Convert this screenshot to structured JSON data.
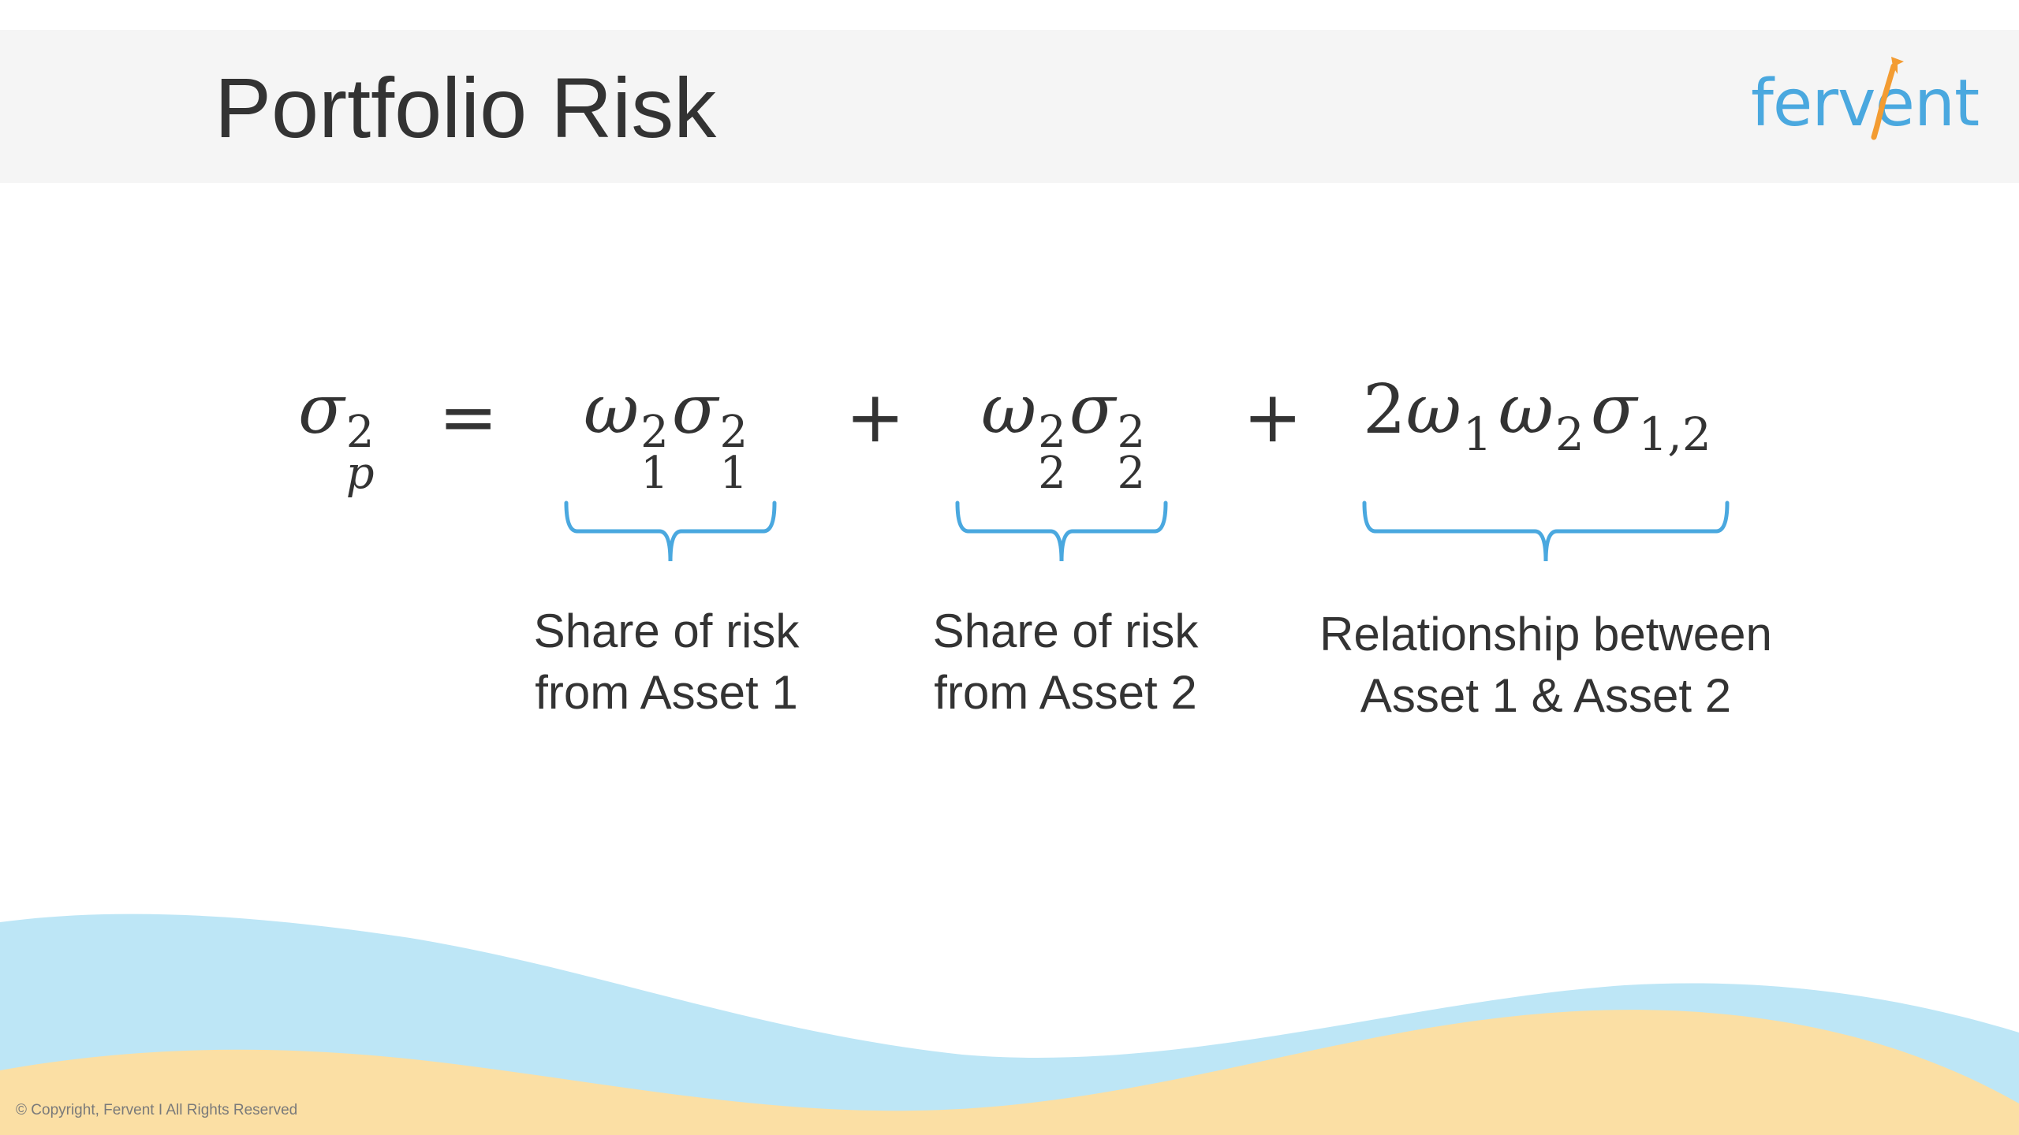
{
  "title": "Portfolio Risk",
  "logo": {
    "text": "fervent",
    "color": "#4aa8df",
    "accent_color": "#f39c32"
  },
  "formula": {
    "lhs": {
      "symbol": "σ",
      "sub": "p",
      "sup": "2"
    },
    "equals": "=",
    "plus": "+",
    "term1": {
      "w": "ω",
      "w_sub": "1",
      "w_sup": "2",
      "s": "σ",
      "s_sub": "1",
      "s_sup": "2"
    },
    "term2": {
      "w": "ω",
      "w_sub": "2",
      "w_sup": "2",
      "s": "σ",
      "s_sub": "2",
      "s_sup": "2"
    },
    "term3": {
      "coef": "2",
      "w": "ω",
      "w1_sub": "1",
      "w2_sub": "2",
      "s": "σ",
      "s_sub": "1,2"
    }
  },
  "annotations": [
    {
      "line1": "Share of risk",
      "line2": "from Asset 1"
    },
    {
      "line1": "Share of risk",
      "line2": "from Asset 2"
    },
    {
      "line1": "Relationship between",
      "line2": "Asset 1 & Asset 2"
    }
  ],
  "colors": {
    "brace": "#4aa8df",
    "wave_blue": "#bde6f6",
    "wave_sand": "#fbdfa4",
    "header_band": "#f5f5f5",
    "text": "#333333"
  },
  "copyright": "© Copyright, Fervent I All Rights Reserved"
}
